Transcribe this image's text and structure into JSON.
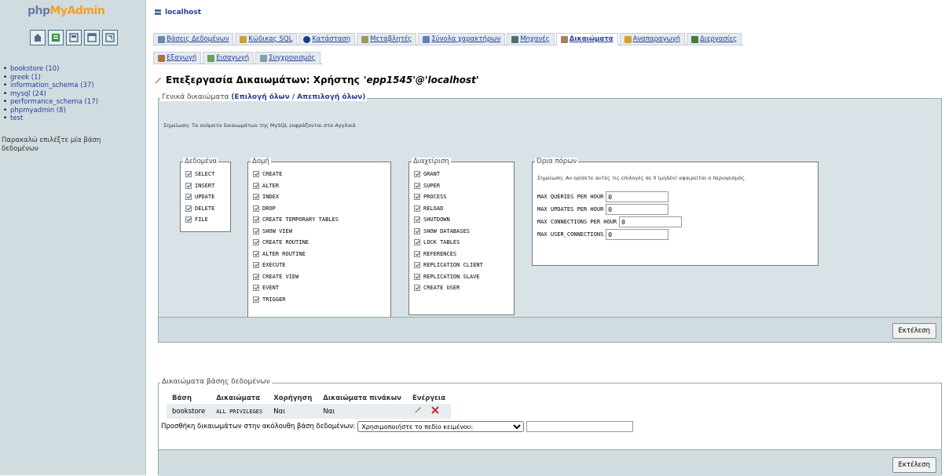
{
  "left": {
    "logo": {
      "php": "php",
      "my": "My",
      "admin": "Admin"
    },
    "quick_icons": [
      "home-icon",
      "sql-query-icon",
      "docs-icon",
      "sql-window-icon",
      "reload-icon"
    ],
    "databases": [
      {
        "label": "bookstore (10)"
      },
      {
        "label": "greek (1)"
      },
      {
        "label": "information_schema (37)"
      },
      {
        "label": "mysql (24)"
      },
      {
        "label": "performance_schema (17)"
      },
      {
        "label": "phpmyadmin (8)"
      },
      {
        "label": "test"
      }
    ],
    "select_hint": "Παρακαλώ επιλέξτε μία βάση δεδομένων"
  },
  "header": {
    "server": "localhost"
  },
  "tabs_row1": [
    {
      "label": "Βάσεις Δεδομένων",
      "color": "#6a8ab0"
    },
    {
      "label": "Κώδικας SQL",
      "color": "#c9a040"
    },
    {
      "label": "Κατάσταση",
      "color": "#1a3a8a"
    },
    {
      "label": "Μεταβλητές",
      "color": "#9a9a60"
    },
    {
      "label": "Σύνολα χαρακτήρων",
      "color": "#6080c0"
    },
    {
      "label": "Μηχανές",
      "color": "#507070"
    },
    {
      "label": "Δικαιώματα",
      "color": "#a08060",
      "active": true
    },
    {
      "label": "Αναπαραγωγή",
      "color": "#d0a030"
    },
    {
      "label": "Διεργασίες",
      "color": "#4a7a3a"
    }
  ],
  "tabs_row2": [
    {
      "label": "Εξαγωγή",
      "color": "#b07040"
    },
    {
      "label": "Εισαγωγή",
      "color": "#70a050"
    },
    {
      "label": "Συγχρονισμός",
      "color": "#80a0b0"
    }
  ],
  "title": {
    "prefix": "Επεξεργασία Δικαιωμάτων: Χρήστης",
    "user": "'epp1545'@'localhost'"
  },
  "global": {
    "legend": "Γενικά δικαιώματα",
    "toggle_link": "(Επιλογή όλων / Απεπιλογή όλων)",
    "note": "Σημείωση: Τα ονόματα δικαιωμάτων της MySQL εκφράζονται στα Αγγλικά",
    "data_title": "Δεδομένα",
    "data_privs": [
      "SELECT",
      "INSERT",
      "UPDATE",
      "DELETE",
      "FILE"
    ],
    "struct_title": "Δομή",
    "struct_privs": [
      "CREATE",
      "ALTER",
      "INDEX",
      "DROP",
      "CREATE TEMPORARY TABLES",
      "SHOW VIEW",
      "CREATE ROUTINE",
      "ALTER ROUTINE",
      "EXECUTE",
      "CREATE VIEW",
      "EVENT",
      "TRIGGER"
    ],
    "admin_title": "Διαχείριση",
    "admin_privs": [
      "GRANT",
      "SUPER",
      "PROCESS",
      "RELOAD",
      "SHUTDOWN",
      "SHOW DATABASES",
      "LOCK TABLES",
      "REFERENCES",
      "REPLICATION CLIENT",
      "REPLICATION SLAVE",
      "CREATE USER"
    ],
    "limits_title": "Όρια πόρων",
    "limits_note": "Σημείωση: Αν ορίσετε αυτές τις επιλογές σε 0 (μηδέν) αφαιρείται ο περιορισμός.",
    "limits": [
      {
        "label": "MAX QUERIES PER HOUR",
        "value": "0"
      },
      {
        "label": "MAX UPDATES PER HOUR",
        "value": "0"
      },
      {
        "label": "MAX CONNECTIONS PER HOUR",
        "value": "0"
      },
      {
        "label": "MAX USER_CONNECTIONS",
        "value": "0"
      }
    ],
    "exec_label": "Εκτέλεση"
  },
  "dbpriv": {
    "legend": "Δικαιώματα βάσης δεδομένων",
    "headers": [
      "Βάση",
      "Δικαιώματα",
      "Χορήγηση",
      "Δικαιώματα πινάκων",
      "Ενέργεια"
    ],
    "row": {
      "db": "bookstore",
      "privs": "ALL PRIVILEGES",
      "grant": "Ναι",
      "table_privs": "Ναι"
    },
    "add_label": "Προσθήκη δικαιωμάτων στην ακόλουθη βάση δεδομένων:",
    "select_value": "Χρησιμοποιήστε το πεδίο κειμένου:",
    "exec_label": "Εκτέλεση"
  }
}
